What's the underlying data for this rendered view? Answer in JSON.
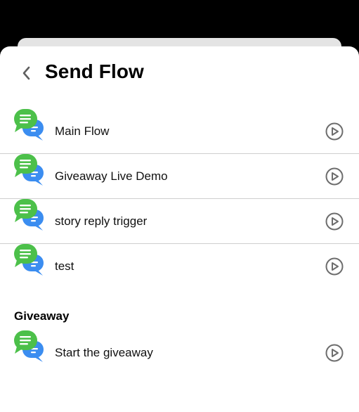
{
  "header": {
    "title": "Send Flow",
    "back_icon": "chevron-left-icon"
  },
  "flows": [
    {
      "label": "Main Flow",
      "icon": "chat-bubbles-icon",
      "action_icon": "play-circle-icon"
    },
    {
      "label": "Giveaway Live Demo",
      "icon": "chat-bubbles-icon",
      "action_icon": "play-circle-icon"
    },
    {
      "label": "story reply trigger",
      "icon": "chat-bubbles-icon",
      "action_icon": "play-circle-icon"
    },
    {
      "label": "test",
      "icon": "chat-bubbles-icon",
      "action_icon": "play-circle-icon"
    }
  ],
  "sections": [
    {
      "title": "Giveaway",
      "flows": [
        {
          "label": "Start the giveaway",
          "icon": "chat-bubbles-icon",
          "action_icon": "play-circle-icon"
        }
      ]
    }
  ],
  "colors": {
    "bubble_green": "#4cc04a",
    "bubble_blue": "#3b8df0",
    "play_icon": "#6d6d6d",
    "divider": "#cfcfcf"
  }
}
